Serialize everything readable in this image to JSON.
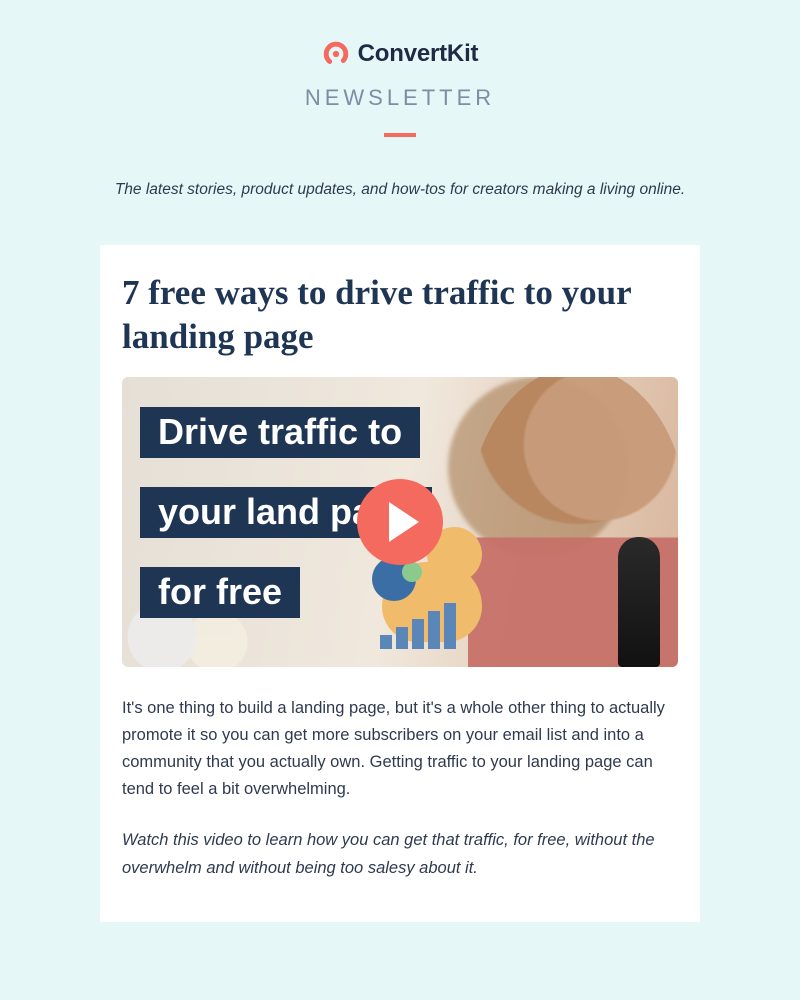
{
  "brand": {
    "name": "ConvertKit",
    "newsletter_label": "NEWSLETTER",
    "accent_color": "#f46a5f"
  },
  "tagline": "The latest stories, product updates, and how-tos for creators making a living online.",
  "article": {
    "title": "7 free ways to drive traffic to your landing page",
    "thumbnail_lines": {
      "line1": "Drive traffic to",
      "line2": "your land       page",
      "line3": "for free"
    },
    "paragraph": "It's one thing to build a landing page, but it's a whole other thing to actually promote it so you can get more subscribers on your email list and into a community that you actually own. Getting traffic to your landing page can tend to feel a bit overwhelming.",
    "cta_text": "Watch this video to learn how you can get that traffic, for free, without the overwhelm and without being too salesy about it."
  }
}
